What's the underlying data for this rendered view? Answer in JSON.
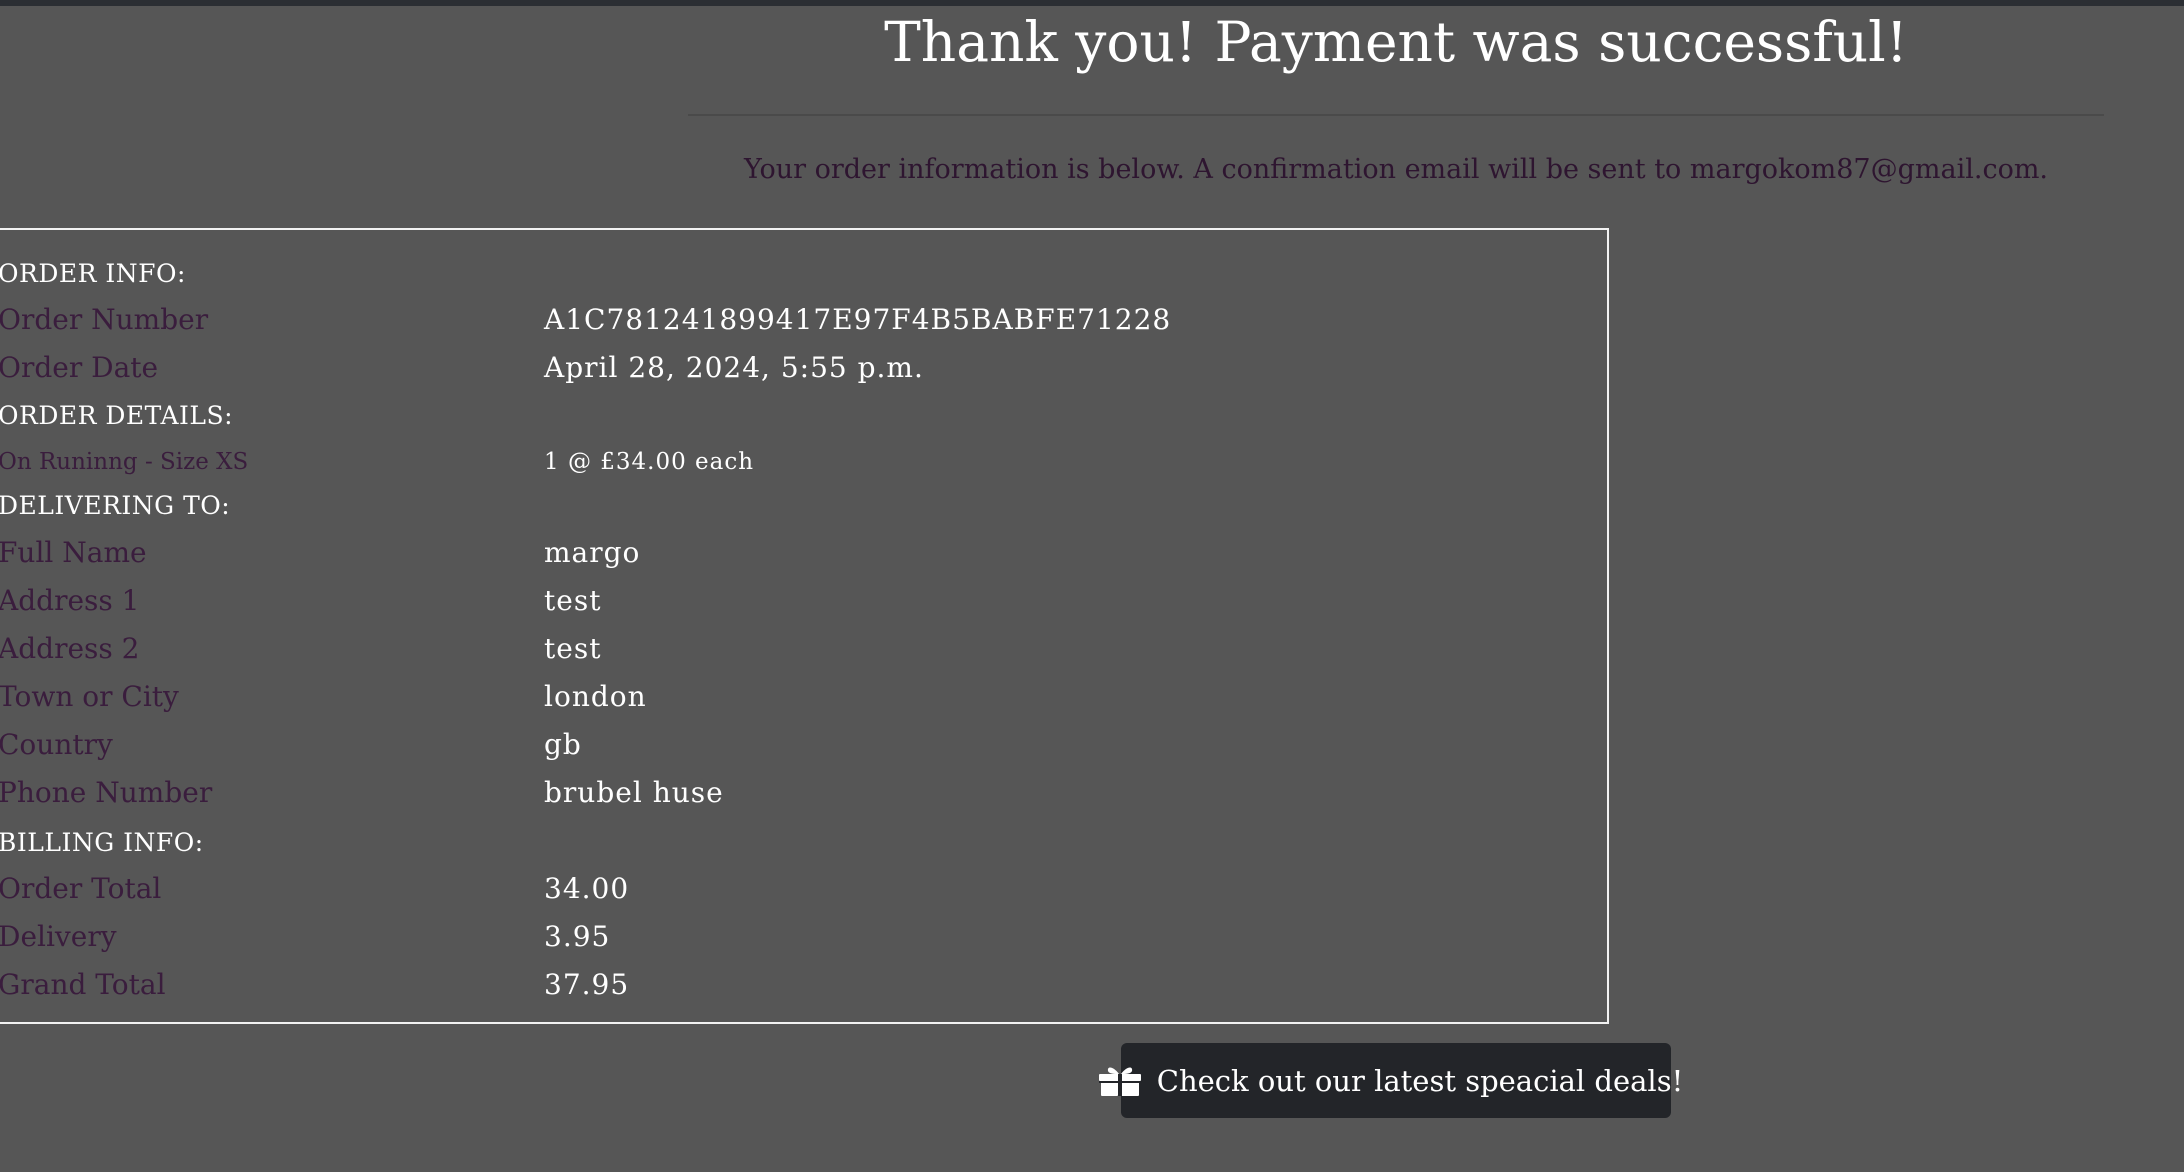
{
  "header": {
    "title": "Thank you! Payment was successful!",
    "confirmation_text": "Your order information is below. A confirmation email will be sent to margokom87@gmail.com."
  },
  "order_info": {
    "heading": "ORDER INFO:",
    "order_number_label": "Order Number",
    "order_number": "A1C781241899417E97F4B5BABFE71228",
    "order_date_label": "Order Date",
    "order_date": "April 28, 2024, 5:55 p.m."
  },
  "order_details": {
    "heading": "ORDER DETAILS:",
    "items": [
      {
        "name": "On Runinng - Size XS",
        "qty_price": "1 @ £34.00 each"
      }
    ]
  },
  "delivery": {
    "heading": "DELIVERING TO:",
    "fields": [
      {
        "label": "Full Name",
        "value": "margo"
      },
      {
        "label": "Address 1",
        "value": "test"
      },
      {
        "label": "Address 2",
        "value": "test"
      },
      {
        "label": "Town or City",
        "value": "london"
      },
      {
        "label": "Country",
        "value": "gb"
      },
      {
        "label": "Phone Number",
        "value": "brubel huse"
      }
    ]
  },
  "billing": {
    "heading": "BILLING INFO:",
    "fields": [
      {
        "label": "Order Total",
        "value": "34.00"
      },
      {
        "label": "Delivery",
        "value": "3.95"
      },
      {
        "label": "Grand Total",
        "value": "37.95"
      }
    ]
  },
  "deals_button": {
    "icon": "gift-icon",
    "label": "Check out our latest speacial deals!"
  },
  "colors": {
    "background": "#565656",
    "label_text": "#3a1d3d",
    "value_text": "#ffffff",
    "button_bg": "#232529"
  }
}
